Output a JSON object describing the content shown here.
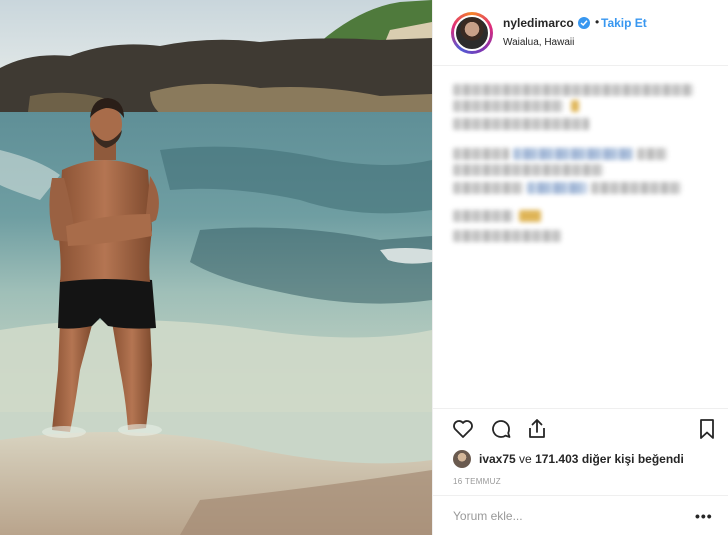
{
  "post": {
    "username": "nyledimarco",
    "follow_separator": "•",
    "follow_label": "Takip Et",
    "location": "Waialua, Hawaii",
    "verified_icon": "verified-badge-icon",
    "caption_blurred": true
  },
  "actions": {
    "like_icon": "heart-icon",
    "comment_icon": "comment-bubble-icon",
    "share_icon": "share-upload-icon",
    "save_icon": "bookmark-icon"
  },
  "likes": {
    "liker": "ivax75",
    "connector": "ve",
    "count": "171.403",
    "suffix": "diğer kişi beğendi"
  },
  "date": "16 TEMMUZ",
  "comment": {
    "placeholder": "Yorum ekle...",
    "more_label": "•••"
  },
  "colors": {
    "accent": "#3897f0",
    "text": "#262626",
    "muted": "#999999",
    "border": "#efefef"
  }
}
